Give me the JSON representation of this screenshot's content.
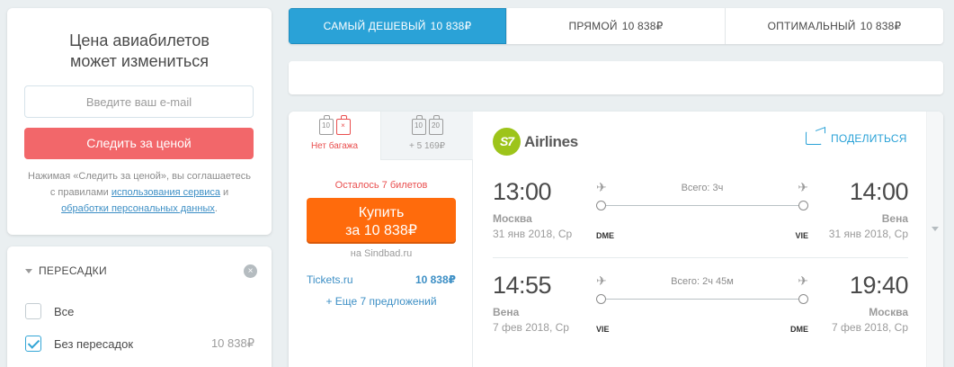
{
  "price_alert": {
    "title_line1": "Цена авиабилетов",
    "title_line2": "может измениться",
    "email_placeholder": "Введите ваш e-mail",
    "button_label": "Следить за ценой",
    "note_part1": "Нажимая «Следить за ценой», вы соглашаетесь с правилами ",
    "note_link1": "использования сервиса",
    "note_part2": " и ",
    "note_link2": "обработки персональных данных",
    "note_part3": "."
  },
  "transfers": {
    "title": "ПЕРЕСАДКИ",
    "clear_icon": "×",
    "options": [
      {
        "label": "Все",
        "checked": false,
        "price": ""
      },
      {
        "label": "Без пересадок",
        "checked": true,
        "price": "10 838₽"
      }
    ]
  },
  "sort_tabs": [
    {
      "label": "Самый дешевый",
      "price": "10 838₽",
      "active": true
    },
    {
      "label": "Прямой",
      "price": "10 838₽",
      "active": false
    },
    {
      "label": "Оптимальный",
      "price": "10 838₽",
      "active": false
    }
  ],
  "ticket": {
    "baggage": {
      "tab1": {
        "icon1": "10",
        "icon2": "×",
        "label": "Нет багажа"
      },
      "tab2": {
        "icon1": "10",
        "icon2": "20",
        "label": "+ 5 169₽"
      }
    },
    "tickets_left": "Осталось 7 билетов",
    "buy_label": "Купить",
    "buy_price": "за 10 838₽",
    "on_agency": "на Sindbad.ru",
    "offer_agency": "Tickets.ru",
    "offer_price": "10 838₽",
    "more_offers": "+ Еще 7 предложений",
    "airline_logo": "S7",
    "airline_name": "Airlines",
    "share_label": "Поделиться",
    "segments": [
      {
        "dep_time": "13:00",
        "dep_city": "Москва",
        "dep_date": "31 янв 2018, Ср",
        "dep_iata": "DME",
        "duration": "Всего: 3ч",
        "arr_time": "14:00",
        "arr_city": "Вена",
        "arr_date": "31 янв 2018, Ср",
        "arr_iata": "VIE"
      },
      {
        "dep_time": "14:55",
        "dep_city": "Вена",
        "dep_date": "7 фев 2018, Ср",
        "dep_iata": "VIE",
        "duration": "Всего: 2ч 45м",
        "arr_time": "19:40",
        "arr_city": "Москва",
        "arr_date": "7 фев 2018, Ср",
        "arr_iata": "DME"
      }
    ]
  },
  "colors": {
    "accent_blue": "#2aa2d7",
    "alert_button": "#f2676a",
    "buy_button": "#ff6b0c",
    "warning_red": "#e94f4f",
    "s7_green": "#9dc41a"
  },
  "icons": {
    "takeoff": "plane-takeoff-icon",
    "landing": "plane-landing-icon",
    "share": "share-icon",
    "baggage": "baggage-icon",
    "scroll": "chevron-down-icon"
  }
}
